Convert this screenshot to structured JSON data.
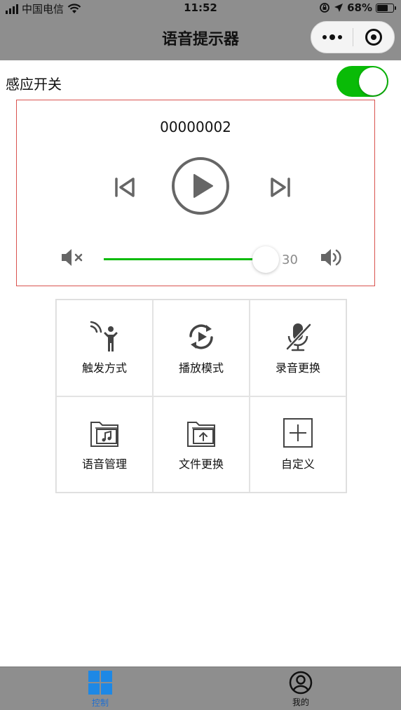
{
  "status_bar": {
    "carrier": "中国电信",
    "time": "11:52",
    "battery": "68%"
  },
  "nav": {
    "title": "语音提示器"
  },
  "sensor": {
    "label": "感应开关",
    "enabled": true
  },
  "player": {
    "track_name": "00000002",
    "volume": 30,
    "volume_fraction": 0.88
  },
  "grid": [
    {
      "label": "触发方式",
      "icon": "trigger-person-icon"
    },
    {
      "label": "播放模式",
      "icon": "loop-play-icon"
    },
    {
      "label": "录音更换",
      "icon": "mic-off-icon"
    },
    {
      "label": "语音管理",
      "icon": "music-folder-icon"
    },
    {
      "label": "文件更换",
      "icon": "upload-folder-icon"
    },
    {
      "label": "自定义",
      "icon": "plus-box-icon"
    }
  ],
  "tabbar": [
    {
      "label": "控制",
      "icon": "grid-icon",
      "active": true
    },
    {
      "label": "我的",
      "icon": "user-icon",
      "active": false
    }
  ],
  "colors": {
    "accent_green": "#09bb07",
    "header_gray": "#8e8e8e",
    "tab_active_blue": "#1f6fd1",
    "panel_border_red": "#d9534f"
  }
}
